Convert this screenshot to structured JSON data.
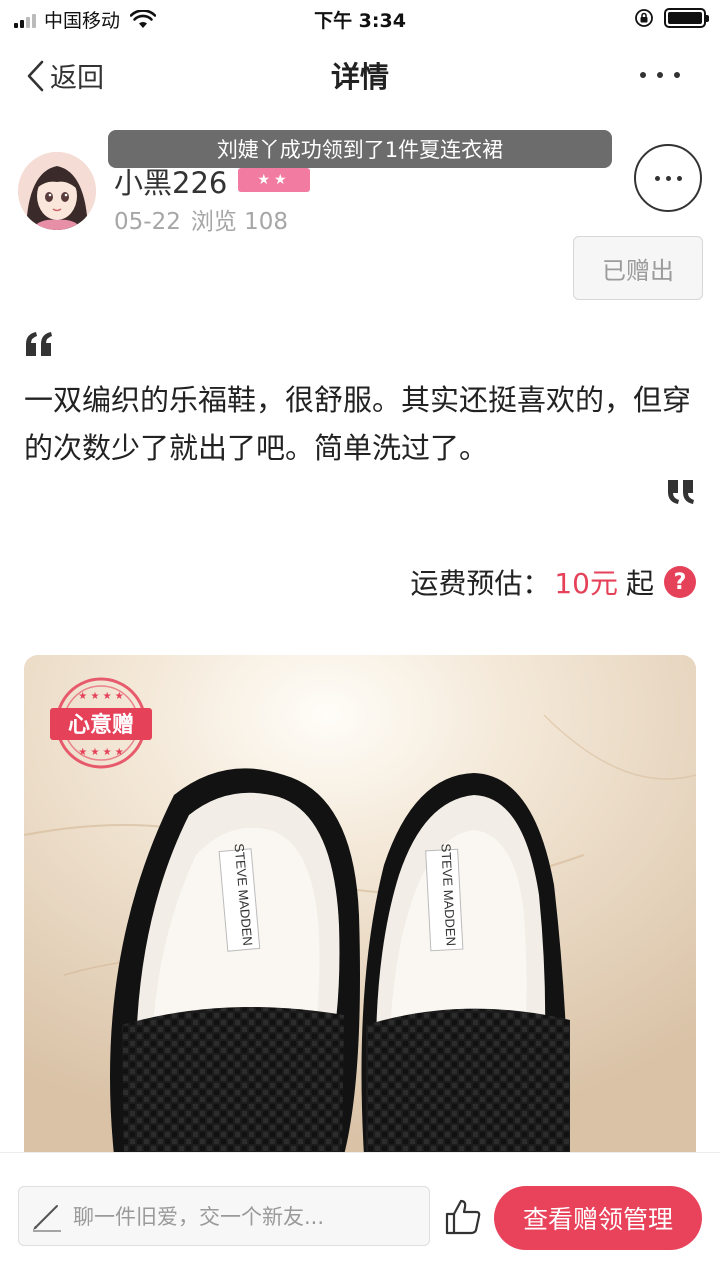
{
  "status_bar": {
    "carrier": "中国移动",
    "time": "下午 3:34"
  },
  "nav": {
    "back_label": "返回",
    "title": "详情"
  },
  "toast": {
    "text": "刘婕丫成功领到了1件夏连衣裙"
  },
  "user": {
    "name": "小黑226",
    "level_stars": "★★",
    "date": "05-22",
    "views": "浏览 108"
  },
  "status_button": {
    "label": "已赠出"
  },
  "post": {
    "description": "一双编织的乐福鞋，很舒服。其实还挺喜欢的，但穿的次数少了就出了吧。简单洗过了。"
  },
  "shipping": {
    "label": "运费预估：",
    "price": "10元",
    "suffix": "起",
    "help_symbol": "?"
  },
  "photo": {
    "stamp_text": "心意赠",
    "label_text_left": "STEVE MADDEN",
    "label_text_right": "STEVE MADDEN"
  },
  "bottom_bar": {
    "chat_placeholder": "聊一件旧爱，交一个新友...",
    "primary_button": "查看赠领管理"
  },
  "colors": {
    "accent": "#e9435c",
    "badge_pink": "#f27ba1",
    "muted_text": "#a6a6a6"
  },
  "icons": [
    "signal-icon",
    "wifi-icon",
    "lock-rotation-icon",
    "battery-icon",
    "back-chevron-icon",
    "more-dots-icon",
    "avatar",
    "quote-open-icon",
    "quote-close-icon",
    "help-icon",
    "stamp-icon",
    "pen-icon",
    "thumbs-up-icon"
  ]
}
